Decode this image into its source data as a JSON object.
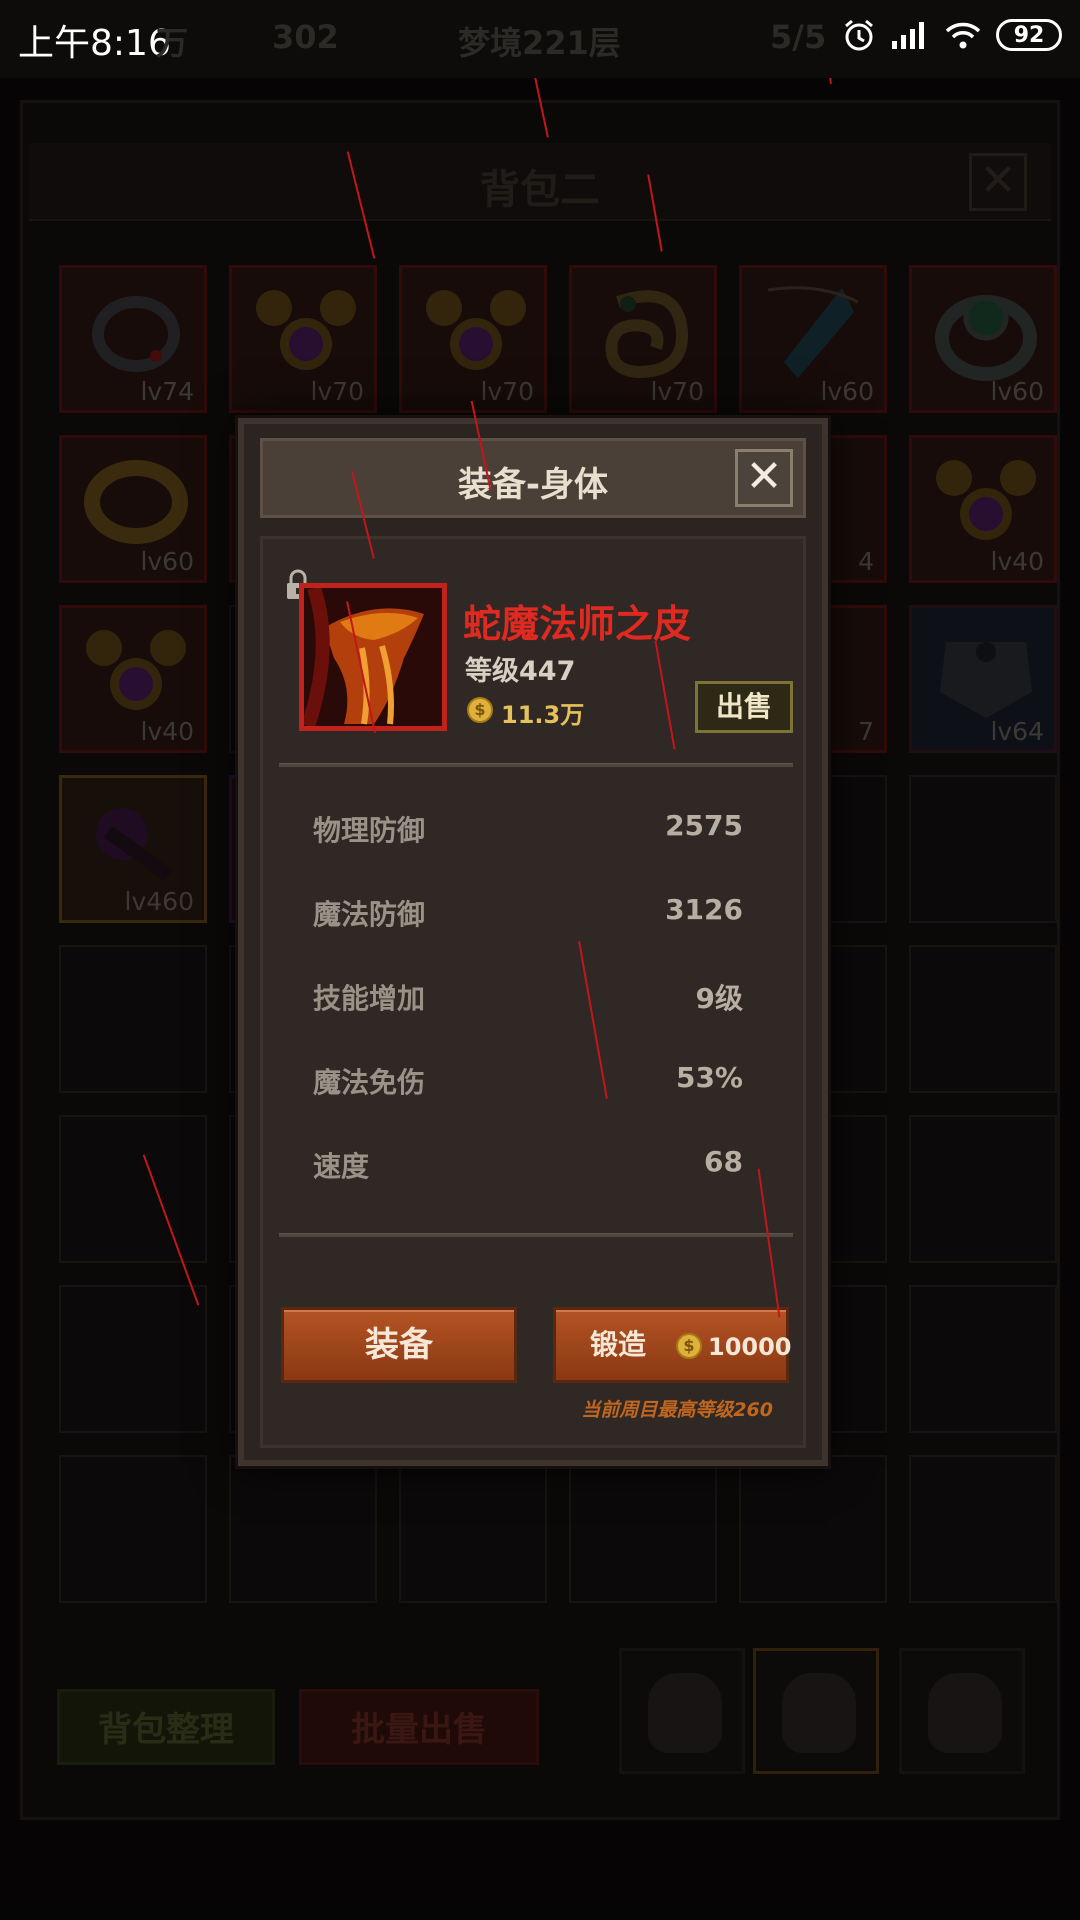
{
  "status_bar": {
    "time": "上午8:16",
    "faded_left": "万",
    "faded_gems": "302",
    "faded_stage": "梦境221层",
    "faded_energy": "5/5",
    "battery": "92"
  },
  "backpack": {
    "title": "背包二",
    "close_symbol": "✕",
    "slots": [
      {
        "level": "lv74",
        "icon": "ring-dark-icon",
        "frame": "red"
      },
      {
        "level": "lv70",
        "icon": "amulet-purple-icon",
        "frame": "red"
      },
      {
        "level": "lv70",
        "icon": "amulet-purple-icon",
        "frame": "red"
      },
      {
        "level": "lv70",
        "icon": "ring-spiral-icon",
        "frame": "red"
      },
      {
        "level": "lv60",
        "icon": "pendant-blue-icon",
        "frame": "red"
      },
      {
        "level": "lv60",
        "icon": "ring-green-icon",
        "frame": "red"
      },
      {
        "level": "lv60",
        "icon": "ring-gold-icon",
        "frame": "red"
      },
      {
        "level": "",
        "icon": "",
        "frame": "red"
      },
      {
        "level": "",
        "icon": "",
        "frame": "none"
      },
      {
        "level": "",
        "icon": "",
        "frame": "none"
      },
      {
        "level": "4",
        "icon": "",
        "frame": "red"
      },
      {
        "level": "lv40",
        "icon": "amulet-purple-icon",
        "frame": "red"
      },
      {
        "level": "lv40",
        "icon": "amulet-purple-icon",
        "frame": "red"
      },
      {
        "level": "",
        "icon": "",
        "frame": "none"
      },
      {
        "level": "",
        "icon": "",
        "frame": "none"
      },
      {
        "level": "",
        "icon": "",
        "frame": "none"
      },
      {
        "level": "7",
        "icon": "",
        "frame": "red"
      },
      {
        "level": "lv64",
        "icon": "armor-dark-icon",
        "frame": "red"
      },
      {
        "level": "lv460",
        "icon": "cloak-purple-icon",
        "frame": "gold"
      },
      {
        "level": "",
        "icon": "",
        "frame": "purple"
      }
    ],
    "sort_button": "背包整理",
    "bulk_sell_button": "批量出售"
  },
  "modal": {
    "title": "装备-身体",
    "close_symbol": "✕",
    "item_name": "蛇魔法师之皮",
    "item_level": "等级447",
    "coin_symbol": "$",
    "price": "11.3万",
    "sell_button": "出售",
    "stats": [
      {
        "label": "物理防御",
        "value": "2575"
      },
      {
        "label": "魔法防御",
        "value": "3126"
      },
      {
        "label": "技能增加",
        "value": "9级"
      },
      {
        "label": "魔法免伤",
        "value": "53%"
      },
      {
        "label": "速度",
        "value": "68"
      }
    ],
    "equip_button": "装备",
    "forge_button": "锻造",
    "forge_cost": "10000",
    "forge_note": "当前周目最高等级260"
  },
  "colors": {
    "item_name": "#e02a21",
    "price": "#e6c05a",
    "action_button": "#b45424",
    "forge_note": "#c0661e",
    "portrait_frame": "#c0231c"
  }
}
